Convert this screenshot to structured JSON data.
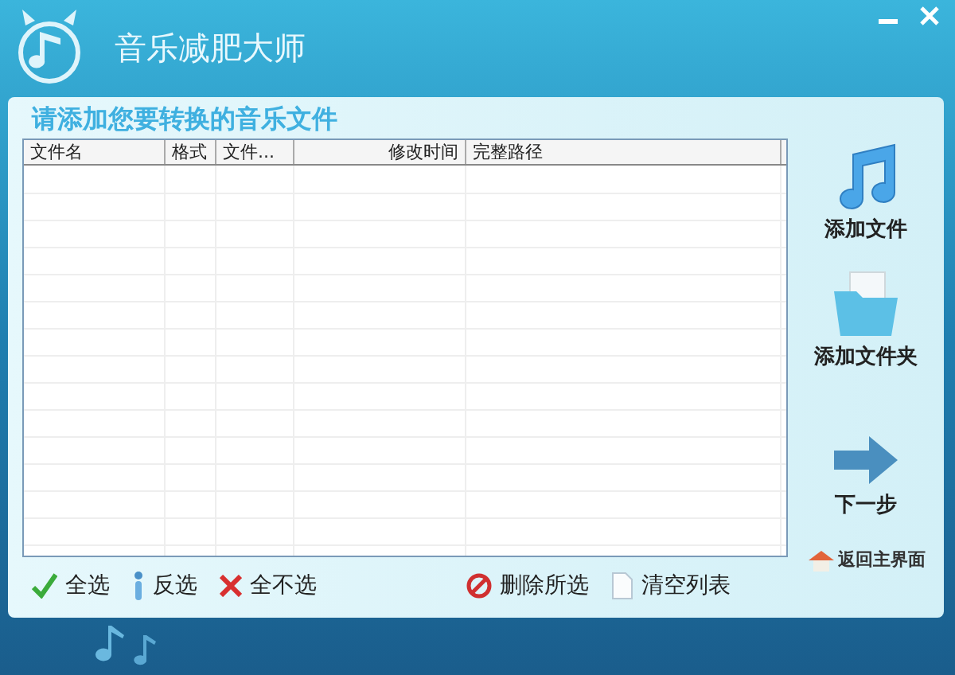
{
  "window": {
    "title": "音乐减肥大师"
  },
  "panel": {
    "heading": "请添加您要转换的音乐文件"
  },
  "table": {
    "columns": [
      {
        "label": "文件名"
      },
      {
        "label": "格式"
      },
      {
        "label": "文件..."
      },
      {
        "label": "修改时间"
      },
      {
        "label": "完整路径"
      }
    ]
  },
  "side_actions": [
    {
      "kind": "music",
      "label": "添加文件"
    },
    {
      "kind": "folder",
      "label": "添加文件夹"
    },
    {
      "kind": "arrow",
      "label": "下一步"
    }
  ],
  "home_link": {
    "label": "返回主界面"
  },
  "toolbar": [
    {
      "kind": "check",
      "label": "全选"
    },
    {
      "kind": "info",
      "label": "反选"
    },
    {
      "kind": "cross",
      "label": "全不选"
    },
    {
      "kind": "delete",
      "label": "删除所选"
    },
    {
      "kind": "page",
      "label": "清空列表"
    }
  ]
}
